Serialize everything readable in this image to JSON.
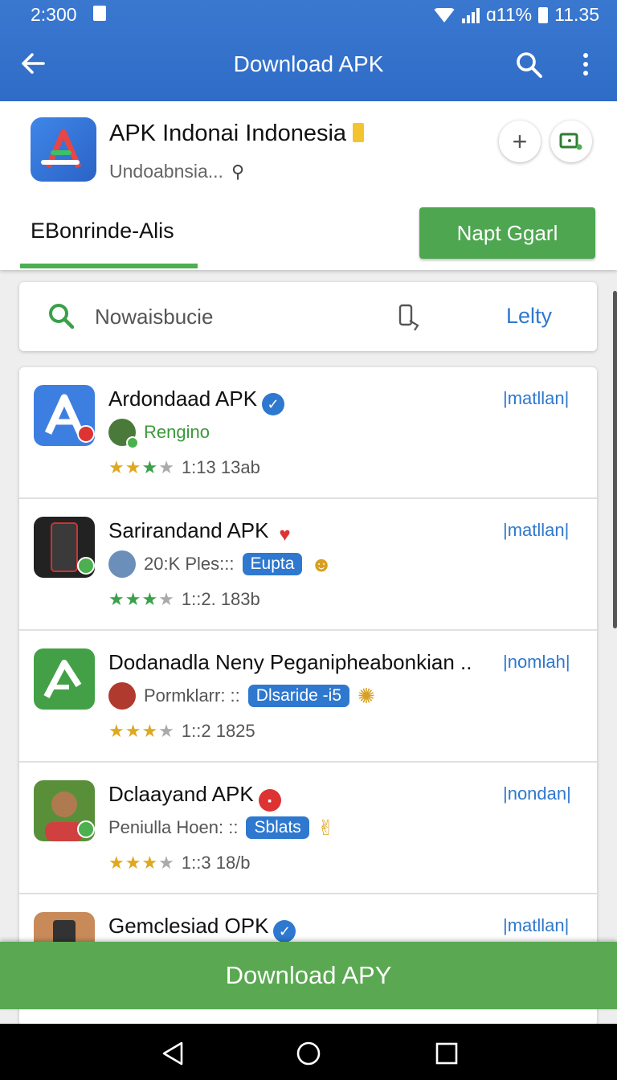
{
  "status_bar": {
    "time": "2:300",
    "battery_text": "ɑ11%",
    "clock": "11.35"
  },
  "app_bar": {
    "title": "Download APK"
  },
  "app_header": {
    "title": "APK Indonai Indonesia",
    "subtitle": "Undoabnsia...",
    "tab_label": "EBonrinde-Alis",
    "primary_button_label": "Napt Ggarl"
  },
  "search": {
    "text": "Nowaisbucie",
    "action_label": "Lelty"
  },
  "apps": [
    {
      "title": "Ardondaad APK",
      "tag": "|matllan|",
      "meta_text": "Rengino",
      "pill": "",
      "rating_text": "1:13 13ab",
      "stars": "★★★★",
      "icon_color": "#3d7fe0",
      "avatar_color": "#4a7a3a"
    },
    {
      "title": "Sarirandand APK",
      "tag": "|matllan|",
      "meta_text": "20:K Ples:::",
      "pill": "Eupta",
      "rating_text": "1::2. 183b",
      "stars": "★★★★",
      "icon_color": "#222222",
      "avatar_color": "#6b8fb8"
    },
    {
      "title": "Dodanadla Neny Peganipheabonkian ..",
      "tag": "|nomlah|",
      "meta_text": "Pormklarr: ::",
      "pill": "Dlsaride -i5",
      "rating_text": "1::2 1825",
      "stars": "★★★★",
      "icon_color": "#43a047",
      "avatar_color": "#b03a2e"
    },
    {
      "title": "Dclaayand APK",
      "tag": "|nondan|",
      "meta_text": "Peniulla Hoen: ::",
      "pill": "Sblats",
      "rating_text": "1::3 18/b",
      "stars": "★★★★",
      "icon_color": "#5a8f3a",
      "avatar_color": ""
    },
    {
      "title": "Gemclesiad OPK",
      "tag": "|matllan|",
      "meta_text": "",
      "pill": "",
      "rating_text": "",
      "stars": "",
      "icon_color": "#c98a5a",
      "avatar_color": ""
    }
  ],
  "download_bar": {
    "label": "Download APY"
  },
  "colors": {
    "app_bar": "#3a78d0",
    "accent_green": "#4ea650",
    "link_blue": "#2f78cf"
  }
}
